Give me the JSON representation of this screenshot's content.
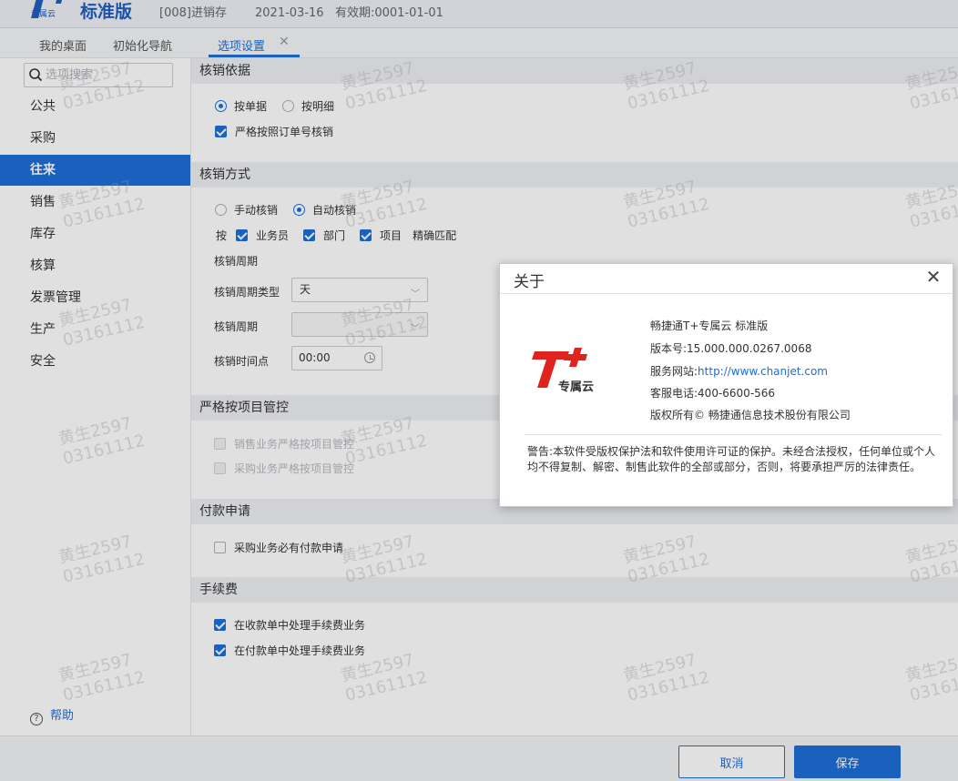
{
  "header": {
    "logo_sub": "专属云",
    "edition": "标准版",
    "account": "[008]进销存",
    "login_info": "2021-03-16   有效期:0001-01-01"
  },
  "tabs": [
    {
      "label": "我的桌面"
    },
    {
      "label": "初始化导航"
    },
    {
      "label": "选项设置",
      "active": true
    }
  ],
  "sidebar": {
    "search_placeholder": "选项搜索",
    "items": [
      {
        "label": "公共"
      },
      {
        "label": "采购"
      },
      {
        "label": "往来",
        "active": true
      },
      {
        "label": "销售"
      },
      {
        "label": "库存"
      },
      {
        "label": "核算"
      },
      {
        "label": "发票管理"
      },
      {
        "label": "生产"
      },
      {
        "label": "安全"
      }
    ],
    "help_label": "帮助"
  },
  "sections": {
    "basis": {
      "title": "核销依据",
      "radio_by_document": "按单据",
      "radio_by_detail": "按明细",
      "strict_order": "严格按照订单号核销"
    },
    "method": {
      "title": "核销方式",
      "radio_manual": "手动核销",
      "radio_auto": "自动核销",
      "by_prefix": "按",
      "cb_salesman": "业务员",
      "cb_department": "部门",
      "cb_project": "项目",
      "exact_match": "精确匹配",
      "period_heading": "核销周期",
      "period_type_label": "核销周期类型",
      "period_type_value": "天",
      "period_label": "核销周期",
      "period_value": "",
      "time_label": "核销时间点",
      "time_value": "00:00"
    },
    "project_control": {
      "title": "严格按项目管控",
      "sales_strict": "销售业务严格按项目管控",
      "purchase_strict": "采购业务严格按项目管控"
    },
    "payment": {
      "title": "付款申请",
      "purchase_required": "采购业务必有付款申请"
    },
    "fee": {
      "title": "手续费",
      "receive_fee": "在收款单中处理手续费业务",
      "pay_fee": "在付款单中处理手续费业务"
    }
  },
  "footer": {
    "cancel_label": "取消",
    "save_label": "保存"
  },
  "about_dialog": {
    "title": "关于",
    "logo_sub": "专属云",
    "product": "畅捷通T+专属云 标准版",
    "version": "版本号:15.000.000.0267.0068",
    "website_label": "服务网站:",
    "website_url": "http://www.chanjet.com",
    "phone": "客服电话:400-6600-566",
    "copyright": "版权所有© 畅捷通信息技术股份有限公司",
    "warning": "警告:本软件受版权保护法和软件使用许可证的保护。未经合法授权，任何单位或个人均不得复制、解密、制售此软件的全部或部分，否则，将要承担严厉的法律责任。"
  },
  "watermark": {
    "line1": "黄生2597",
    "line2": "03161112"
  },
  "colors": {
    "accent": "#1d6fd8",
    "logo_red": "#e0231c"
  }
}
